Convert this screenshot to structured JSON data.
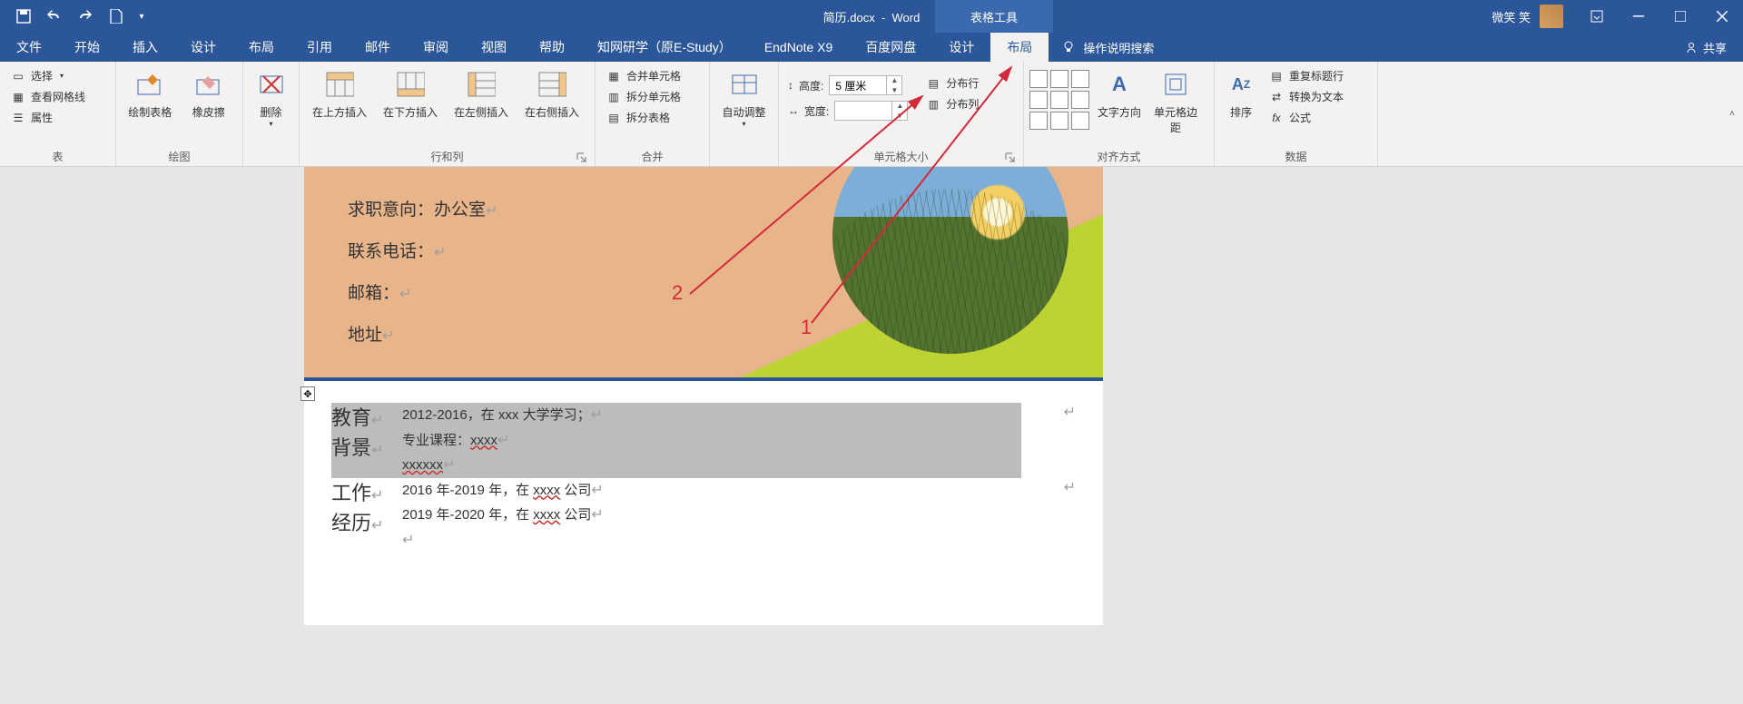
{
  "title": {
    "doc": "简历.docx",
    "app": "Word",
    "tools": "表格工具",
    "user": "微笑 笑"
  },
  "tabs": [
    "文件",
    "开始",
    "插入",
    "设计",
    "布局",
    "引用",
    "邮件",
    "审阅",
    "视图",
    "帮助",
    "知网研学（原E-Study）",
    "EndNote X9",
    "百度网盘",
    "设计",
    "布局"
  ],
  "active_tab_index": 14,
  "tellme": "操作说明搜索",
  "share": "共享",
  "ribbon": {
    "g_table": {
      "label": "表",
      "select": "选择",
      "gridlines": "查看网格线",
      "props": "属性"
    },
    "g_draw": {
      "label": "绘图",
      "draw": "绘制表格",
      "eraser": "橡皮擦"
    },
    "g_delete": {
      "label": "删除"
    },
    "g_rowcol": {
      "label": "行和列",
      "above": "在上方插入",
      "below": "在下方插入",
      "left": "在左侧插入",
      "right": "在右侧插入"
    },
    "g_merge": {
      "label": "合并",
      "merge": "合并单元格",
      "split": "拆分单元格",
      "splittbl": "拆分表格"
    },
    "g_autofit": {
      "label": "自动调整"
    },
    "g_cellsize": {
      "label": "单元格大小",
      "height": "高度:",
      "width": "宽度:",
      "height_val": "5 厘米",
      "width_val": "",
      "dist_rows": "分布行",
      "dist_cols": "分布列"
    },
    "g_align": {
      "label": "对齐方式",
      "textdir": "文字方向",
      "margins": "单元格边距"
    },
    "g_data": {
      "label": "数据",
      "sort": "排序",
      "repeat": "重复标题行",
      "totext": "转换为文本",
      "formula": "公式"
    }
  },
  "doc": {
    "l1": "求职意向：办公室",
    "l2": "联系电话：",
    "l3": "邮箱：",
    "l4": "地址",
    "sec1_title_a": "教育",
    "sec1_title_b": "背景",
    "sec1_r1": "2012-2016，在 xxx 大学学习；",
    "sec1_r2_pre": "专业课程：",
    "sec1_r2_w": "xxxx",
    "sec1_r3_w": "xxxxxx",
    "sec2_title_a": "工作",
    "sec2_title_b": "经历",
    "sec2_r1_pre": "2016 年-2019 年，在 ",
    "sec2_r1_w": "xxxx",
    "sec2_r1_post": " 公司",
    "sec2_r2_pre": "2019 年-2020 年，在 ",
    "sec2_r2_w": "xxxx",
    "sec2_r2_post": " 公司"
  },
  "annot": {
    "n1": "1",
    "n2": "2"
  }
}
